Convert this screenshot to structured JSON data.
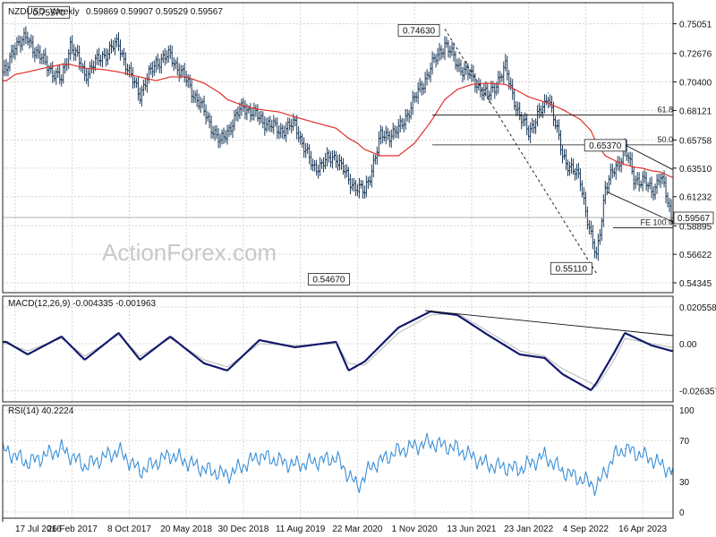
{
  "header": {
    "symbol": "NZDUSD",
    "timeframe": "Weekly",
    "ohlc": "0.59869 0.59907 0.59529 0.59567"
  },
  "watermark": "ActionForex.com",
  "colors": {
    "price": "#1c3b5a",
    "sma": "#e0322b",
    "macd": "#131a6b",
    "signal": "#b8b8b8",
    "rsi": "#3b8fd6",
    "grid": "#d6d6d6",
    "annot": "#111111",
    "watermark": "#c9c9c9"
  },
  "price_annotations": [
    {
      "label": "0.75570",
      "x_date": "2017-02-19",
      "value": 0.7557
    },
    {
      "label": "0.54670",
      "x_date": "2020-03-22",
      "value": 0.5467
    },
    {
      "label": "0.74630",
      "x_date": "2021-02-28",
      "value": 0.7463
    },
    {
      "label": "0.55110",
      "x_date": "2022-10-16",
      "value": 0.5511
    },
    {
      "label": "0.65370",
      "x_date": "2023-02-05",
      "value": 0.6537
    }
  ],
  "fib_levels": [
    {
      "label": "61.8",
      "value": 0.6776
    },
    {
      "label": "50.0",
      "value": 0.6537
    },
    {
      "label": "FE 100.0",
      "value": 0.5875
    }
  ],
  "current_price": {
    "label": "0.59567",
    "value": 0.59567
  },
  "macd_label": "MACD(12,26,9) -0.004335 -0.001963",
  "rsi_label": "RSI(14) 40.2224",
  "chart_data": [
    {
      "type": "ohlc",
      "ylim": [
        0.54345,
        0.7609
      ],
      "yticks": [
        0.75051,
        0.72676,
        0.704,
        0.68121,
        0.65758,
        0.6351,
        0.61232,
        0.58895,
        0.56622,
        0.54345
      ],
      "xticks": [
        {
          "label": "17 Jul 2016",
          "date": "2016-07-17"
        },
        {
          "label": "26 Feb 2017",
          "date": "2017-02-26"
        },
        {
          "label": "8 Oct 2017",
          "date": "2017-10-08"
        },
        {
          "label": "20 May 2018",
          "date": "2018-05-20"
        },
        {
          "label": "30 Dec 2018",
          "date": "2018-12-30"
        },
        {
          "label": "11 Aug 2019",
          "date": "2019-08-11"
        },
        {
          "label": "22 Mar 2020",
          "date": "2020-03-22"
        },
        {
          "label": "1 Nov 2020",
          "date": "2020-11-01"
        },
        {
          "label": "13 Jun 2021",
          "date": "2021-06-13"
        },
        {
          "label": "23 Jan 2022",
          "date": "2022-01-23"
        },
        {
          "label": "4 Sep 2022",
          "date": "2022-09-04"
        },
        {
          "label": "16 Apr 2023",
          "date": "2023-04-16"
        }
      ],
      "x": [
        "2016-06-12",
        "2016-07-17",
        "2016-09-04",
        "2016-11-06",
        "2017-01-15",
        "2017-02-19",
        "2017-04-16",
        "2017-06-25",
        "2017-08-27",
        "2017-10-08",
        "2017-11-19",
        "2018-01-21",
        "2018-03-18",
        "2018-05-20",
        "2018-07-29",
        "2018-09-30",
        "2018-10-28",
        "2018-12-30",
        "2019-03-03",
        "2019-05-19",
        "2019-07-21",
        "2019-09-29",
        "2019-12-29",
        "2020-02-16",
        "2020-03-22",
        "2020-04-19",
        "2020-06-21",
        "2020-08-30",
        "2020-11-01",
        "2021-01-03",
        "2021-02-28",
        "2021-04-18",
        "2021-06-13",
        "2021-08-15",
        "2021-10-24",
        "2021-12-19",
        "2022-01-23",
        "2022-03-27",
        "2022-04-10",
        "2022-06-05",
        "2022-08-14",
        "2022-09-25",
        "2022-10-16",
        "2022-11-20",
        "2023-01-08",
        "2023-02-05",
        "2023-03-12",
        "2023-04-16",
        "2023-05-21",
        "2023-06-25",
        "2023-08-06"
      ],
      "series": [
        {
          "name": "",
          "values": [
            0.712,
            0.735,
            0.738,
            0.72,
            0.705,
            0.735,
            0.71,
            0.725,
            0.735,
            0.71,
            0.695,
            0.72,
            0.725,
            0.705,
            0.68,
            0.655,
            0.665,
            0.685,
            0.675,
            0.665,
            0.67,
            0.635,
            0.645,
            0.625,
            0.62,
            0.615,
            0.66,
            0.665,
            0.69,
            0.715,
            0.735,
            0.718,
            0.708,
            0.692,
            0.715,
            0.675,
            0.665,
            0.685,
            0.695,
            0.645,
            0.625,
            0.58,
            0.563,
            0.62,
            0.638,
            0.652,
            0.626,
            0.626,
            0.616,
            0.63,
            0.596
          ]
        },
        {
          "name": "",
          "values": [
            0.705,
            0.71,
            0.712,
            0.715,
            0.718,
            0.718,
            0.715,
            0.714,
            0.712,
            0.71,
            0.708,
            0.705,
            0.708,
            0.708,
            0.703,
            0.695,
            0.69,
            0.685,
            0.682,
            0.68,
            0.676,
            0.672,
            0.667,
            0.659,
            0.655,
            0.65,
            0.645,
            0.645,
            0.655,
            0.672,
            0.69,
            0.698,
            0.702,
            0.703,
            0.702,
            0.696,
            0.692,
            0.688,
            0.687,
            0.682,
            0.674,
            0.665,
            0.655,
            0.645,
            0.64,
            0.638,
            0.636,
            0.635,
            0.633,
            0.632,
            0.628
          ]
        }
      ]
    },
    {
      "type": "line",
      "ylim": [
        -0.03,
        0.024
      ],
      "yticks": [
        0.020558,
        0.0,
        -0.026357
      ],
      "x": [
        "2016-06-12",
        "2016-09-04",
        "2017-01-15",
        "2017-04-16",
        "2017-08-27",
        "2017-11-19",
        "2018-03-18",
        "2018-07-29",
        "2018-10-28",
        "2019-03-03",
        "2019-07-21",
        "2019-12-29",
        "2020-02-16",
        "2020-04-19",
        "2020-08-30",
        "2021-01-03",
        "2021-04-18",
        "2021-08-15",
        "2021-12-19",
        "2022-03-27",
        "2022-06-05",
        "2022-09-25",
        "2022-10-16",
        "2022-12-25",
        "2023-02-05",
        "2023-05-21",
        "2023-08-06"
      ],
      "series": [
        {
          "name": "",
          "values": [
            0.001,
            -0.006,
            0.004,
            -0.009,
            0.006,
            -0.009,
            0.004,
            -0.011,
            -0.015,
            0.002,
            -0.002,
            0.001,
            -0.015,
            -0.01,
            0.009,
            0.018,
            0.016,
            0.005,
            -0.006,
            -0.008,
            -0.017,
            -0.026,
            -0.022,
            -0.005,
            0.006,
            -0.001,
            -0.004
          ]
        },
        {
          "name": "",
          "values": [
            0.0,
            -0.004,
            0.003,
            -0.007,
            0.005,
            -0.007,
            0.003,
            -0.009,
            -0.013,
            0.0,
            -0.001,
            0.0,
            -0.011,
            -0.012,
            0.006,
            0.016,
            0.017,
            0.007,
            -0.004,
            -0.007,
            -0.014,
            -0.022,
            -0.024,
            -0.009,
            0.003,
            0.0,
            -0.002
          ]
        }
      ]
    },
    {
      "type": "line",
      "ylim": [
        0,
        100
      ],
      "yticks": [
        100,
        70,
        30,
        0
      ],
      "x": [
        "2016-06-12",
        "2016-09-04",
        "2017-01-15",
        "2017-04-16",
        "2017-08-27",
        "2017-11-19",
        "2018-03-18",
        "2018-07-29",
        "2018-10-28",
        "2019-03-03",
        "2019-07-21",
        "2019-12-29",
        "2020-03-22",
        "2020-05-17",
        "2020-08-30",
        "2020-12-27",
        "2021-04-18",
        "2021-08-15",
        "2021-12-19",
        "2022-03-27",
        "2022-06-05",
        "2022-09-25",
        "2022-10-16",
        "2022-12-25",
        "2023-02-05",
        "2023-05-21",
        "2023-08-06"
      ],
      "series": [
        {
          "name": "",
          "values": [
            60,
            48,
            62,
            45,
            60,
            40,
            56,
            42,
            36,
            55,
            46,
            53,
            25,
            45,
            60,
            68,
            62,
            46,
            42,
            55,
            40,
            28,
            24,
            55,
            62,
            52,
            40
          ]
        }
      ]
    }
  ]
}
